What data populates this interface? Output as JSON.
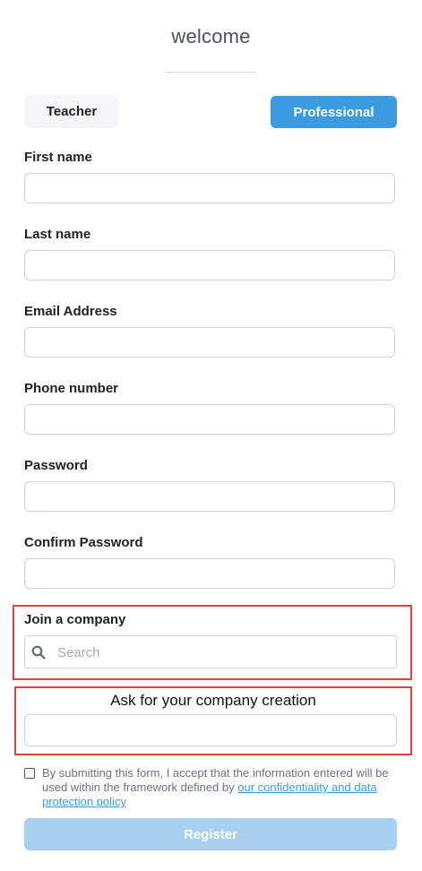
{
  "header": {
    "title": "welcome"
  },
  "account_type": {
    "teacher_label": "Teacher",
    "professional_label": "Professional"
  },
  "form": {
    "first_name_label": "First name",
    "last_name_label": "Last name",
    "email_label": "Email Address",
    "phone_label": "Phone number",
    "password_label": "Password",
    "confirm_password_label": "Confirm Password",
    "join_company_label": "Join a company",
    "search_placeholder": "Search",
    "ask_company_label": "Ask for your company creation"
  },
  "consent": {
    "text": "By submitting this form, I accept that the information entered will be used within the framework defined by",
    "link": "our confidentiality and data protection policy"
  },
  "register_label": "Register",
  "colors": {
    "accent": "#3b9be0",
    "accent_disabled": "#a8d0f0",
    "highlight_border": "#e0413f",
    "field_border": "#c9d2da"
  }
}
